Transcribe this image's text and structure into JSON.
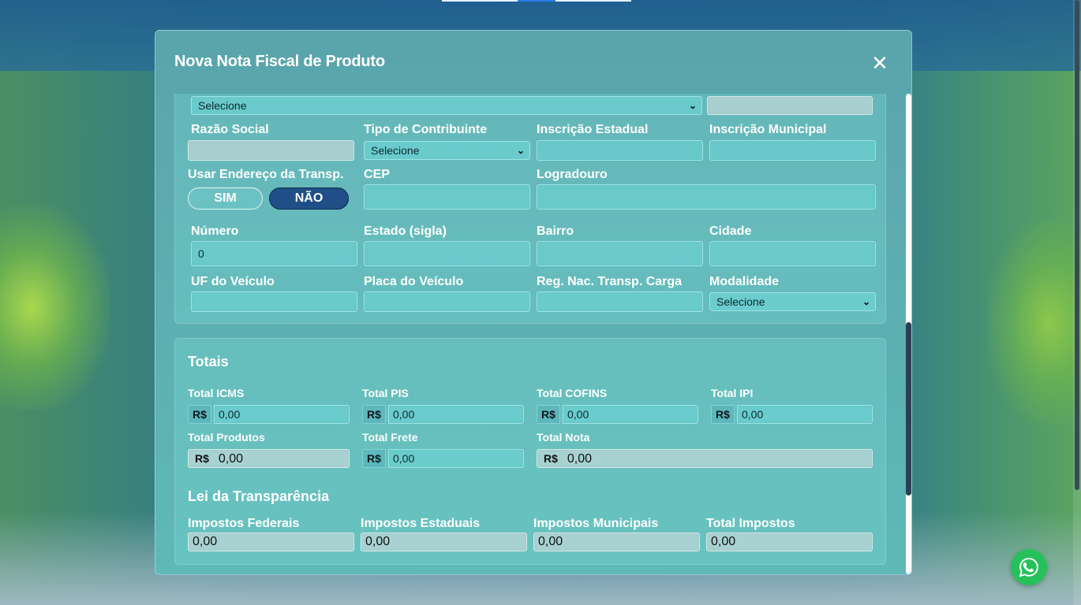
{
  "modal": {
    "title": "Nova Nota Fiscal de Produto",
    "close_glyph": "✕"
  },
  "transport": {
    "top_select": "Selecione",
    "top_field": "",
    "razao_social": {
      "label": "Razão Social",
      "value": ""
    },
    "tipo_contribuinte": {
      "label": "Tipo de Contribuinte",
      "value": "Selecione"
    },
    "inscricao_estadual": {
      "label": "Inscrição Estadual",
      "value": ""
    },
    "inscricao_municipal": {
      "label": "Inscrição Municipal",
      "value": ""
    },
    "usar_endereco": {
      "label": "Usar Endereço da Transp.",
      "sim": "SIM",
      "nao": "NÃO",
      "selected": "NÃO"
    },
    "cep": {
      "label": "CEP",
      "value": ""
    },
    "logradouro": {
      "label": "Logradouro",
      "value": ""
    },
    "numero": {
      "label": "Número",
      "value": "0"
    },
    "estado": {
      "label": "Estado (sigla)",
      "value": ""
    },
    "bairro": {
      "label": "Bairro",
      "value": ""
    },
    "cidade": {
      "label": "Cidade",
      "value": ""
    },
    "uf_veiculo": {
      "label": "UF do Veículo",
      "value": ""
    },
    "placa_veiculo": {
      "label": "Placa do Veículo",
      "value": ""
    },
    "rntc": {
      "label": "Reg. Nac. Transp. Carga",
      "value": ""
    },
    "modalidade": {
      "label": "Modalidade",
      "value": "Selecione"
    }
  },
  "totais": {
    "title": "Totais",
    "currency": "R$",
    "total_icms": {
      "label": "Total ICMS",
      "value": "0,00"
    },
    "total_pis": {
      "label": "Total PIS",
      "value": "0,00"
    },
    "total_cofins": {
      "label": "Total COFINS",
      "value": "0,00"
    },
    "total_ipi": {
      "label": "Total IPI",
      "value": "0,00"
    },
    "total_produtos": {
      "label": "Total Produtos",
      "value": "0,00"
    },
    "total_frete": {
      "label": "Total Frete",
      "value": "0,00"
    },
    "total_nota": {
      "label": "Total Nota",
      "value": "0,00"
    }
  },
  "transparencia": {
    "title": "Lei da Transparência",
    "federais": {
      "label": "Impostos Federais",
      "value": "0,00"
    },
    "estaduais": {
      "label": "Impostos Estaduais",
      "value": "0,00"
    },
    "municipais": {
      "label": "Impostos Municipais",
      "value": "0,00"
    },
    "total": {
      "label": "Total Impostos",
      "value": "0,00"
    }
  },
  "colors": {
    "toggle_active": "#1f4f86",
    "whatsapp": "#27c15c"
  },
  "icons": {
    "close": "close-icon",
    "chevron": "chevron-down-icon",
    "whatsapp": "whatsapp-icon"
  }
}
